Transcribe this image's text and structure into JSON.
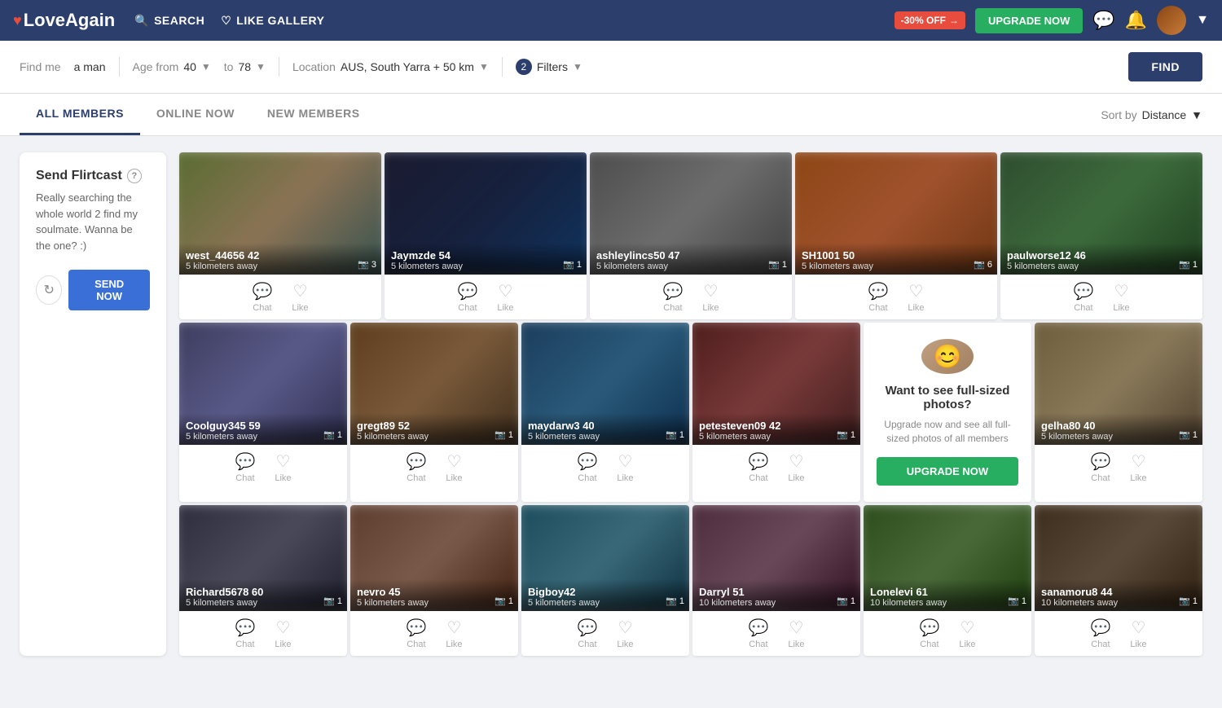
{
  "header": {
    "logo_text": "LoveAgain",
    "nav_items": [
      {
        "id": "search",
        "label": "SEARCH",
        "icon": "🔍"
      },
      {
        "id": "like-gallery",
        "label": "LIKE GALLERY",
        "icon": "♡"
      }
    ],
    "discount_badge": "-30% OFF",
    "upgrade_button": "UPGRADE NOW",
    "arrow_down": "▼"
  },
  "search_bar": {
    "find_me_label": "Find me",
    "find_me_value": "a man",
    "age_from_label": "Age from",
    "age_from_value": "40",
    "age_to_label": "to",
    "age_to_value": "78",
    "location_label": "Location",
    "location_value": "AUS, South Yarra + 50 km",
    "filters_label": "Filters",
    "filters_count": "2",
    "find_button": "FIND"
  },
  "tabs": {
    "items": [
      {
        "id": "all-members",
        "label": "ALL MEMBERS",
        "active": true
      },
      {
        "id": "online-now",
        "label": "ONLINE NOW",
        "active": false
      },
      {
        "id": "new-members",
        "label": "NEW MEMBERS",
        "active": false
      }
    ],
    "sort_label": "Sort by",
    "sort_value": "Distance"
  },
  "flirtcast": {
    "title": "Send Flirtcast",
    "help_icon": "?",
    "message": "Really searching the whole world 2 find my soulmate. Wanna be the one? :)",
    "send_button": "SEND NOW",
    "refresh_icon": "↻"
  },
  "members_row1": [
    {
      "id": "west_44656",
      "name": "west_44656",
      "age": "42",
      "distance": "5 kilometers away",
      "photos": "3",
      "photo_class": "photo-1"
    },
    {
      "id": "jaymzde",
      "name": "Jaymzde",
      "age": "54",
      "distance": "5 kilometers away",
      "photos": "1",
      "photo_class": "photo-2"
    },
    {
      "id": "ashleylincs50",
      "name": "ashleylincs50",
      "age": "47",
      "distance": "5 kilometers away",
      "photos": "1",
      "photo_class": "photo-3"
    },
    {
      "id": "sh1001",
      "name": "SH1001",
      "age": "50",
      "distance": "5 kilometers away",
      "photos": "6",
      "photo_class": "photo-4"
    },
    {
      "id": "paulworse12",
      "name": "paulworse12",
      "age": "46",
      "distance": "5 kilometers away",
      "photos": "1",
      "photo_class": "photo-5"
    }
  ],
  "members_row2": [
    {
      "id": "coolguy345",
      "name": "Coolguy345",
      "age": "59",
      "distance": "5 kilometers away",
      "photos": "1",
      "photo_class": "photo-6"
    },
    {
      "id": "gregt89",
      "name": "gregt89",
      "age": "52",
      "distance": "5 kilometers away",
      "photos": "1",
      "photo_class": "photo-7"
    },
    {
      "id": "maydarw3",
      "name": "maydarw3",
      "age": "40",
      "distance": "5 kilometers away",
      "photos": "1",
      "photo_class": "photo-8"
    },
    {
      "id": "petesteven09",
      "name": "petesteven09",
      "age": "42",
      "distance": "5 kilometers away",
      "photos": "1",
      "photo_class": "photo-9"
    },
    {
      "id": "gelha80",
      "name": "gelha80",
      "age": "40",
      "distance": "5 kilometers away",
      "photos": "1",
      "photo_class": "photo-10"
    }
  ],
  "members_row3": [
    {
      "id": "richard5678",
      "name": "Richard5678",
      "age": "60",
      "distance": "5 kilometers away",
      "photos": "1",
      "photo_class": "photo-row3-1"
    },
    {
      "id": "nevro",
      "name": "nevro",
      "age": "45",
      "distance": "5 kilometers away",
      "photos": "1",
      "photo_class": "photo-row3-2"
    },
    {
      "id": "bigboy42",
      "name": "Bigboy42",
      "age": "",
      "distance": "5 kilometers away",
      "photos": "1",
      "photo_class": "photo-row3-3"
    },
    {
      "id": "darryl",
      "name": "Darryl",
      "age": "51",
      "distance": "10 kilometers away",
      "photos": "1",
      "photo_class": "photo-row3-4"
    },
    {
      "id": "lonelevi",
      "name": "Lonelevi",
      "age": "61",
      "distance": "10 kilometers away",
      "photos": "1",
      "photo_class": "photo-row3-5"
    },
    {
      "id": "sanamoru8",
      "name": "sanamoru8",
      "age": "44",
      "distance": "10 kilometers away",
      "photos": "1",
      "photo_class": "photo-row3-6"
    }
  ],
  "upgrade_prompt": {
    "title": "Want to see full-sized photos?",
    "subtitle": "Upgrade now and see all full-sized photos of all members",
    "button": "UPGRADE NOW"
  },
  "action_labels": {
    "chat": "Chat",
    "like": "Like"
  }
}
